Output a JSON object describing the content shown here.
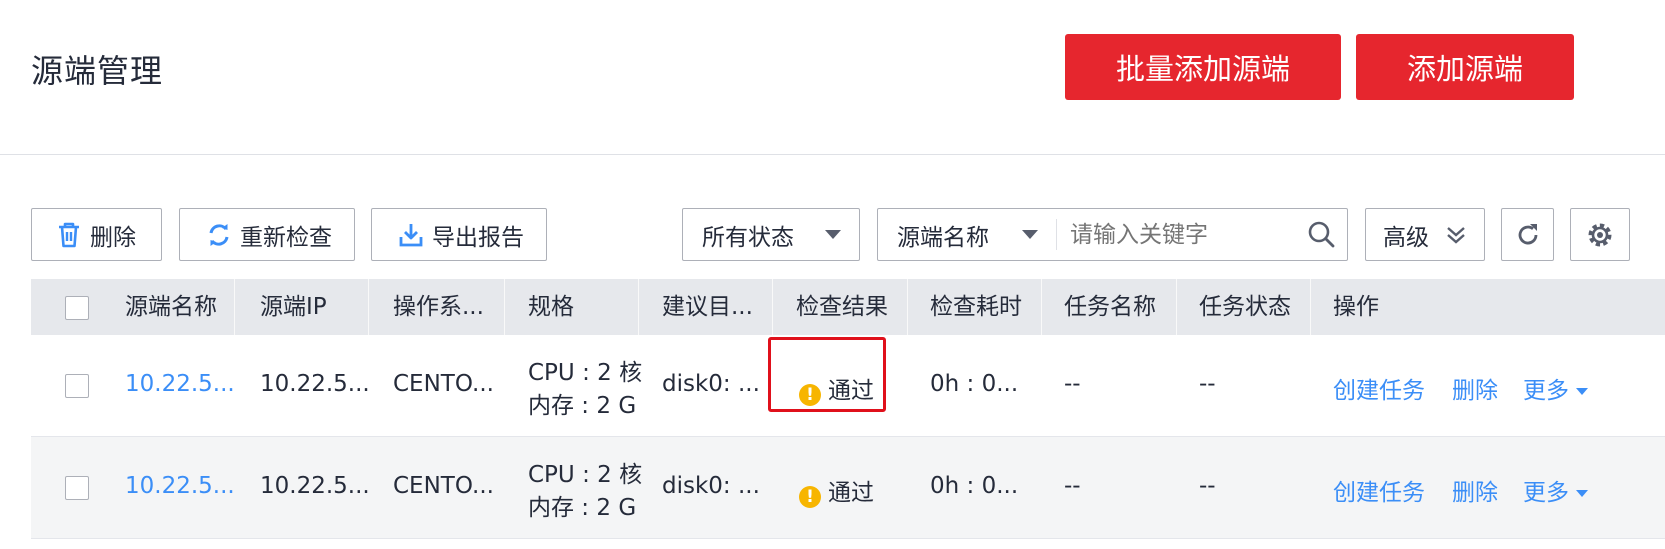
{
  "header": {
    "title": "源端管理",
    "batch_add_label": "批量添加源端",
    "add_label": "添加源端"
  },
  "toolbar": {
    "delete_label": "删除",
    "recheck_label": "重新检查",
    "export_label": "导出报告",
    "status_filter": "所有状态",
    "search_field": "源端名称",
    "search_placeholder": "请输入关键字",
    "advanced_label": "高级"
  },
  "table": {
    "columns": [
      "源端名称",
      "源端IP",
      "操作系...",
      "规格",
      "建议目...",
      "检查结果",
      "检查耗时",
      "任务名称",
      "任务状态",
      "操作"
    ],
    "rows": [
      {
        "name": "10.22.5...",
        "ip": "10.22.5...",
        "os": "CENTO...",
        "spec_cpu": "CPU : 2 核",
        "spec_mem": "内存 : 2 G",
        "target": "disk0: ...",
        "result": "通过",
        "duration": "0h : 0...",
        "task_name": "--",
        "task_status": "--",
        "action_create": "创建任务",
        "action_delete": "删除",
        "action_more": "更多"
      },
      {
        "name": "10.22.5...",
        "ip": "10.22.5...",
        "os": "CENTO...",
        "spec_cpu": "CPU : 2 核",
        "spec_mem": "内存 : 2 G",
        "target": "disk0: ...",
        "result": "通过",
        "duration": "0h : 0...",
        "task_name": "--",
        "task_status": "--",
        "action_create": "创建任务",
        "action_delete": "删除",
        "action_more": "更多"
      }
    ]
  },
  "colors": {
    "primary_red": "#e6262e",
    "link_blue": "#3b8ef7",
    "warning_yellow": "#f7b500",
    "highlight_border": "#e0101b",
    "header_bg": "#e6e8ec"
  },
  "icons": [
    "trash-icon",
    "refresh-icon",
    "download-icon",
    "search-icon",
    "double-chevron-down-icon",
    "reload-icon",
    "gear-icon",
    "warning-icon"
  ]
}
